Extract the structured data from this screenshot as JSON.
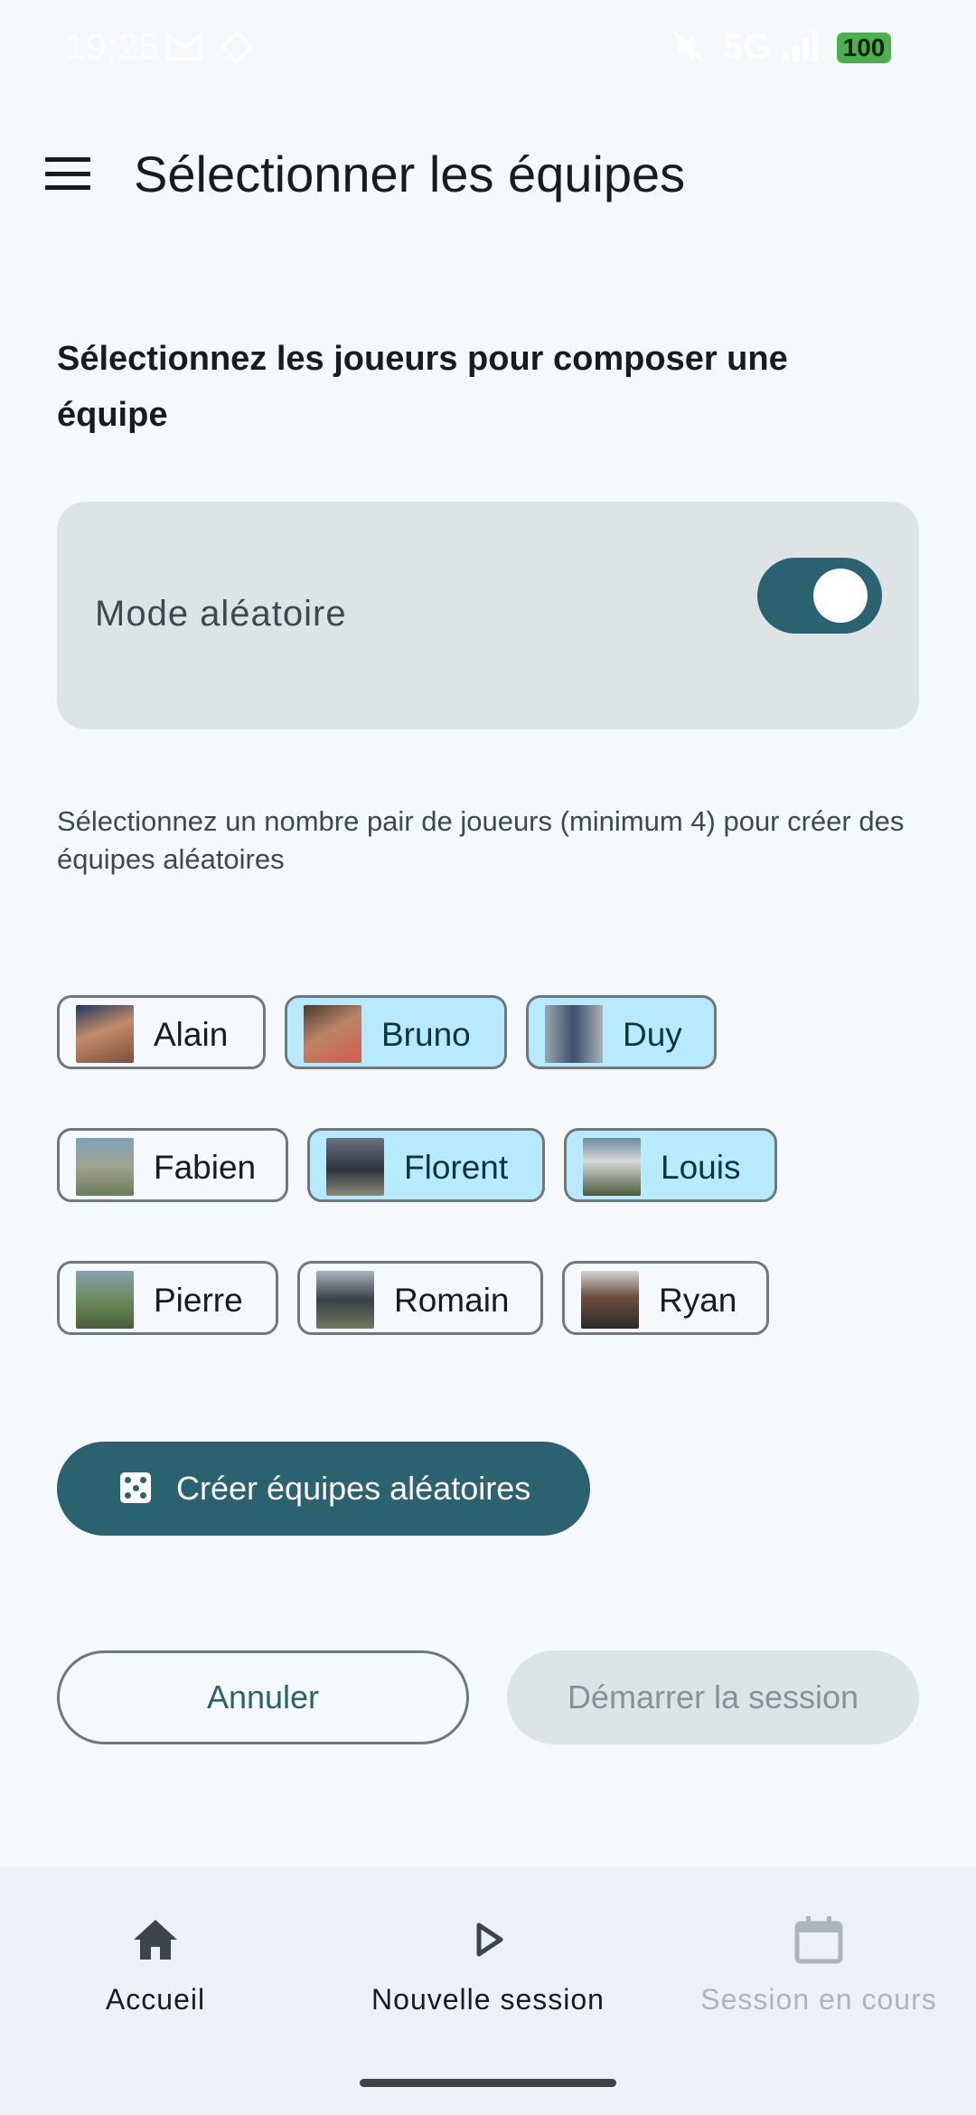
{
  "status_bar": {
    "time": "19:25",
    "network": "5G",
    "battery": "100"
  },
  "header": {
    "title": "Sélectionner les équipes"
  },
  "main": {
    "subtitle": "Sélectionnez les joueurs pour composer une équipe",
    "random_mode": {
      "label": "Mode aléatoire",
      "enabled": true
    },
    "hint": "Sélectionnez un nombre pair de joueurs (minimum 4) pour créer des équipes aléatoires",
    "players": [
      {
        "name": "Alain",
        "selected": false
      },
      {
        "name": "Bruno",
        "selected": true
      },
      {
        "name": "Duy",
        "selected": true
      },
      {
        "name": "Fabien",
        "selected": false
      },
      {
        "name": "Florent",
        "selected": true
      },
      {
        "name": "Louis",
        "selected": true
      },
      {
        "name": "Pierre",
        "selected": false
      },
      {
        "name": "Romain",
        "selected": false
      },
      {
        "name": "Ryan",
        "selected": false
      }
    ],
    "create_button_label": "Créer équipes aléatoires",
    "cancel_label": "Annuler",
    "start_label": "Démarrer la session"
  },
  "bottom_nav": {
    "items": [
      {
        "label": "Accueil",
        "icon": "home-icon"
      },
      {
        "label": "Nouvelle session",
        "icon": "play-icon"
      },
      {
        "label": "Session en cours",
        "icon": "calendar-icon"
      }
    ]
  },
  "colors": {
    "primary": "#2a6270",
    "chip_selected": "#b8eaff",
    "card_bg": "#dee3e6",
    "background": "#f5f9fc"
  }
}
